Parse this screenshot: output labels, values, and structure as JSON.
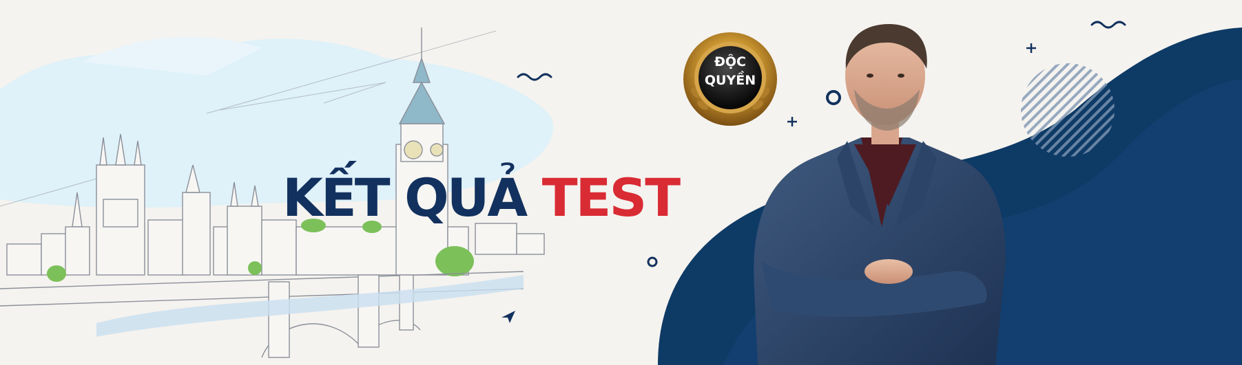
{
  "headline": {
    "part1": "KẾT QUẢ",
    "part2": "TEST"
  },
  "badge": {
    "line1": "ĐỘC",
    "line2": "QUYỀN"
  },
  "colors": {
    "background": "#f5f3ef",
    "navy": "#12315e",
    "red": "#d92b34",
    "gold": "#c6922f",
    "sky": "#dff1f9"
  },
  "icons": [
    "wave-icon",
    "plus-icon",
    "ring-icon",
    "paper-plane-icon",
    "striped-circle-icon",
    "laurel-icon"
  ]
}
